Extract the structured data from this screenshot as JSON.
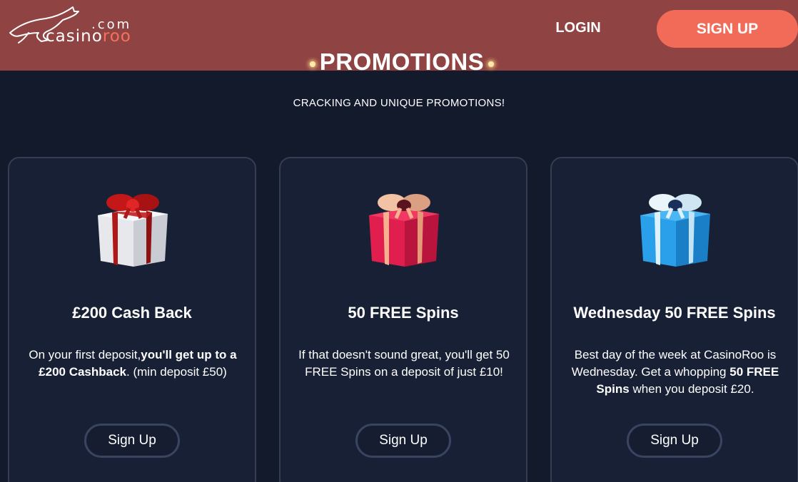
{
  "header": {
    "logo": {
      "dotcom": ".com",
      "name_prefix": "casino",
      "name_suffix": "roo"
    },
    "login_label": "LOGIN",
    "signup_label": "SIGN UP"
  },
  "page": {
    "title": "PROMOTIONS",
    "subtitle": "CRACKING AND UNIQUE PROMOTIONS!"
  },
  "colors": {
    "header_bg": "#8f4342",
    "accent": "#f26b58",
    "page_bg": "#131a2b",
    "card_bg": "#182035"
  },
  "promotions": [
    {
      "icon": "white-gift-box-icon",
      "title": "£200 Cash Back",
      "desc_1": "On your first deposit,",
      "desc_2": "you'll get up to a £200 Cashback",
      "desc_3": ". (min deposit £50)",
      "button": "Sign Up"
    },
    {
      "icon": "red-gift-box-icon",
      "title": "50 FREE Spins",
      "desc_1": "If that doesn't sound great, you'll get 50 FREE Spins on a deposit of just £10!",
      "button": "Sign Up"
    },
    {
      "icon": "blue-gift-box-icon",
      "title": "Wednesday 50 FREE Spins",
      "desc_1": "Best day of the week at CasinoRoo is Wednesday. Get a whopping ",
      "desc_2": "50 FREE Spins",
      "desc_3": " when you deposit £20.",
      "button": "Sign Up"
    }
  ]
}
